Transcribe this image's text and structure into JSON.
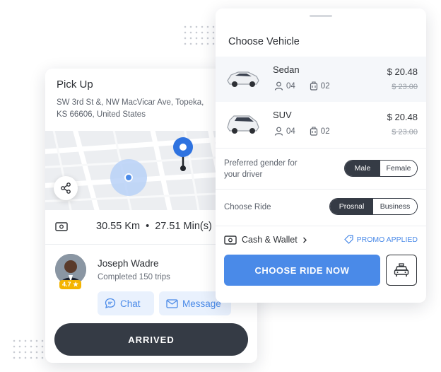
{
  "pickup": {
    "title": "Pick Up",
    "address": "SW 3rd St &, NW MacVicar Ave, Topeka, KS 66606, United States"
  },
  "trip": {
    "distance": "30.55 Km",
    "separator": "•",
    "duration": "27.51 Min(s)"
  },
  "driver": {
    "name": "Joseph Wadre",
    "trips": "Completed 150 trips",
    "rating": "4.7 ★",
    "chat_label": "Chat",
    "message_label": "Message"
  },
  "arrived_label": "ARRIVED",
  "vehicle_panel": {
    "title": "Choose Vehicle",
    "vehicles": [
      {
        "name": "Sedan",
        "passengers": "04",
        "bags": "02",
        "price": "$ 20.48",
        "old_price": "$ 23.00"
      },
      {
        "name": "SUV",
        "passengers": "04",
        "bags": "02",
        "price": "$ 20.48",
        "old_price": "$ 23.00"
      }
    ],
    "gender": {
      "label": "Preferred gender for your driver",
      "options": [
        "Male",
        "Female"
      ],
      "selected": "Male"
    },
    "ride": {
      "label": "Choose Ride",
      "options": [
        "Prosnal",
        "Business"
      ],
      "selected": "Prosnal"
    },
    "payment": "Cash & Wallet",
    "promo": "PROMO APPLIED",
    "cta": "CHOOSE RIDE NOW"
  },
  "colors": {
    "accent": "#4a8ae8",
    "dark": "#353b45",
    "rating": "#f4b400"
  },
  "icons": [
    "share-icon",
    "cash-icon",
    "chat-icon",
    "mail-icon",
    "user-icon",
    "luggage-icon",
    "tag-icon",
    "chevron-right-icon",
    "taxi-icon",
    "location-pin-icon"
  ]
}
